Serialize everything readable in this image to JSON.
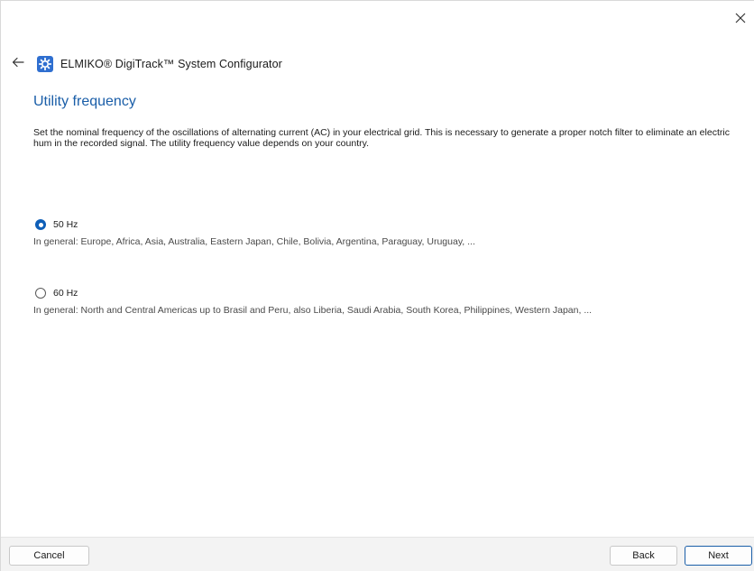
{
  "window": {
    "close_icon": "close-icon"
  },
  "header": {
    "back_icon": "back-arrow-icon",
    "app_icon": "gear-app-icon",
    "app_title": "ELMIKO® DigiTrack™ System Configurator"
  },
  "page": {
    "title": "Utility frequency",
    "description": "Set the nominal frequency of the oscillations of alternating current (AC) in your electrical grid. This is necessary to generate a proper notch filter to eliminate an electric hum in the recorded signal. The utility frequency value depends on your country."
  },
  "options": [
    {
      "label": "50 Hz",
      "description": "In general: Europe, Africa, Asia, Australia, Eastern Japan, Chile, Bolivia, Argentina, Paraguay, Uruguay, ...",
      "selected": true
    },
    {
      "label": "60 Hz",
      "description": "In general: North and Central Americas up to Brasil and Peru, also Liberia, Saudi Arabia, South Korea, Philippines, Western Japan, ...",
      "selected": false
    }
  ],
  "footer": {
    "cancel_label": "Cancel",
    "back_label": "Back",
    "next_label": "Next"
  },
  "colors": {
    "accent": "#0f5fb8",
    "title": "#1a5ea8",
    "app_icon_bg": "#2f6fd0"
  }
}
